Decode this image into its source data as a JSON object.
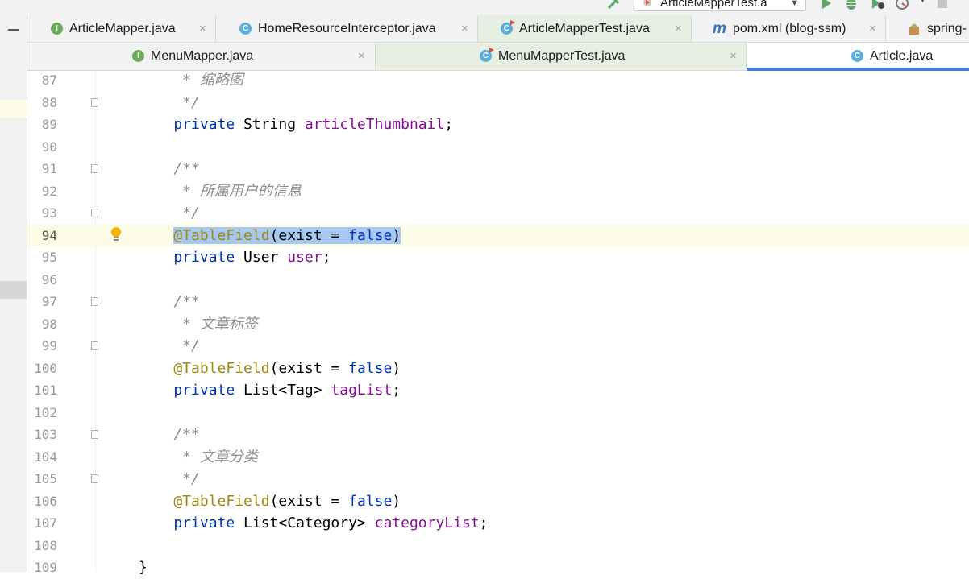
{
  "toolbar": {
    "run_config_label": "ArticleMapperTest.a",
    "colors": {
      "run": "#59a869",
      "debug": "#59a869",
      "stop": "#c4c4c4"
    }
  },
  "tabs_row1": [
    {
      "label": "ArticleMapper.java",
      "icon": "interface-icon",
      "close": "×"
    },
    {
      "label": "HomeResourceInterceptor.java",
      "icon": "class-icon",
      "close": "×"
    },
    {
      "label": "ArticleMapperTest.java",
      "icon": "test-class-icon",
      "close": "×"
    },
    {
      "label": "pom.xml (blog-ssm)",
      "icon": "maven-icon",
      "close": "×"
    },
    {
      "label": "spring-",
      "icon": "spring-config-icon"
    }
  ],
  "tabs_row2": [
    {
      "label": "MenuMapper.java",
      "icon": "interface-icon",
      "close": "×"
    },
    {
      "label": "MenuMapperTest.java",
      "icon": "test-class-icon",
      "close": "×"
    },
    {
      "label": "Article.java",
      "icon": "class-icon"
    }
  ],
  "icon_letters": {
    "interface": "I",
    "class": "C",
    "maven": "m"
  },
  "editor": {
    "current_line": 94,
    "lines": [
      {
        "num": "87",
        "parts": [
          [
            "cmt",
            "     * 缩略图"
          ]
        ]
      },
      {
        "num": "88",
        "parts": [
          [
            "cmt",
            "     */"
          ]
        ],
        "fold": true
      },
      {
        "num": "89",
        "parts": [
          [
            "kw",
            "    private "
          ],
          [
            "",
            "String "
          ],
          [
            "fld",
            "articleThumbnail"
          ],
          [
            "",
            ";"
          ]
        ]
      },
      {
        "num": "90",
        "parts": []
      },
      {
        "num": "91",
        "parts": [
          [
            "cmt",
            "    /**"
          ]
        ],
        "fold": true
      },
      {
        "num": "92",
        "parts": [
          [
            "cmt",
            "     * 所属用户的信息"
          ]
        ]
      },
      {
        "num": "93",
        "parts": [
          [
            "cmt",
            "     */"
          ]
        ],
        "fold": true
      },
      {
        "num": "94",
        "parts": [
          [
            "",
            "    "
          ],
          [
            "ann sel",
            "@TableField"
          ],
          [
            "sel",
            "(exist = "
          ],
          [
            "kw sel",
            "false"
          ],
          [
            "sel",
            ")"
          ]
        ],
        "bulb": true
      },
      {
        "num": "95",
        "parts": [
          [
            "kw",
            "    private "
          ],
          [
            "",
            "User "
          ],
          [
            "fld",
            "user"
          ],
          [
            "",
            ";"
          ]
        ]
      },
      {
        "num": "96",
        "parts": []
      },
      {
        "num": "97",
        "parts": [
          [
            "cmt",
            "    /**"
          ]
        ],
        "fold": true
      },
      {
        "num": "98",
        "parts": [
          [
            "cmt",
            "     * 文章标签"
          ]
        ]
      },
      {
        "num": "99",
        "parts": [
          [
            "cmt",
            "     */"
          ]
        ],
        "fold": true
      },
      {
        "num": "100",
        "parts": [
          [
            "ann",
            "    @TableField"
          ],
          [
            "",
            "(exist = "
          ],
          [
            "kw",
            "false"
          ],
          [
            "",
            ")"
          ]
        ]
      },
      {
        "num": "101",
        "parts": [
          [
            "kw",
            "    private "
          ],
          [
            "",
            "List<Tag> "
          ],
          [
            "fld",
            "tagList"
          ],
          [
            "",
            ";"
          ]
        ]
      },
      {
        "num": "102",
        "parts": []
      },
      {
        "num": "103",
        "parts": [
          [
            "cmt",
            "    /**"
          ]
        ],
        "fold": true
      },
      {
        "num": "104",
        "parts": [
          [
            "cmt",
            "     * 文章分类"
          ]
        ]
      },
      {
        "num": "105",
        "parts": [
          [
            "cmt",
            "     */"
          ]
        ],
        "fold": true
      },
      {
        "num": "106",
        "parts": [
          [
            "ann",
            "    @TableField"
          ],
          [
            "",
            "(exist = "
          ],
          [
            "kw",
            "false"
          ],
          [
            "",
            ")"
          ]
        ]
      },
      {
        "num": "107",
        "parts": [
          [
            "kw",
            "    private "
          ],
          [
            "",
            "List<Category> "
          ],
          [
            "fld",
            "categoryList"
          ],
          [
            "",
            ";"
          ]
        ]
      },
      {
        "num": "108",
        "parts": []
      },
      {
        "num": "109",
        "parts": [
          [
            "",
            "}"
          ]
        ]
      }
    ]
  }
}
